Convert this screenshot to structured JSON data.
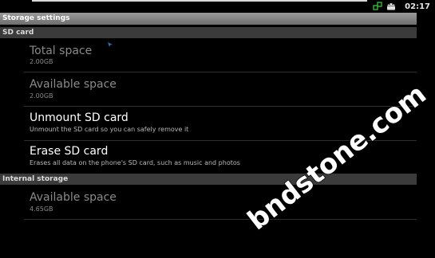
{
  "status_bar": {
    "time": "02:17",
    "icons": [
      "usb-connected-icon",
      "android-debug-icon"
    ]
  },
  "title": "Storage settings",
  "sections": [
    {
      "header": "SD card",
      "items": [
        {
          "title": "Total space",
          "summary": "2.00GB",
          "enabled": false
        },
        {
          "title": "Available space",
          "summary": "2.00GB",
          "enabled": false
        },
        {
          "title": "Unmount SD card",
          "summary": "Unmount the SD card so you can safely remove it",
          "enabled": true
        },
        {
          "title": "Erase SD card",
          "summary": "Erases all data on the phone's SD card, such as music and photos",
          "enabled": true
        }
      ]
    },
    {
      "header": "Internal storage",
      "items": [
        {
          "title": "Available space",
          "summary": "4.65GB",
          "enabled": false
        }
      ]
    }
  ],
  "watermark": "bndstone.com"
}
